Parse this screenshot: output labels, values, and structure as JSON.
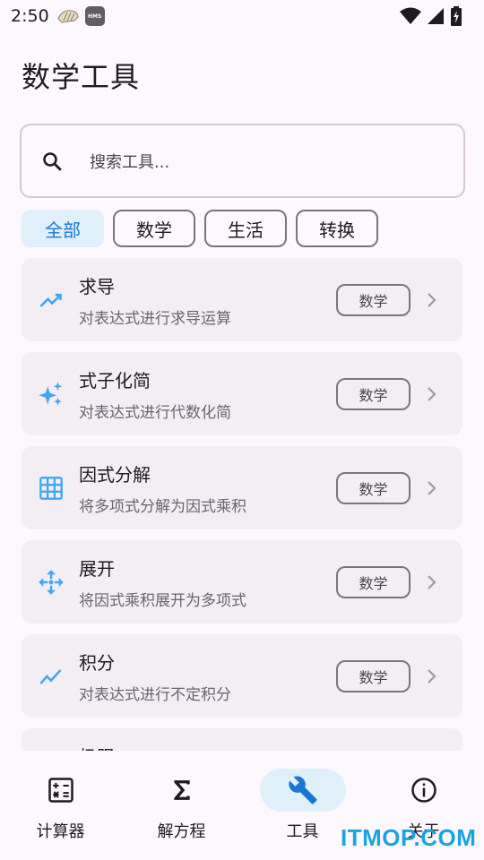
{
  "status_bar": {
    "time": "2:50",
    "notif_icons": [
      "shell-icon",
      "hms-icon"
    ],
    "hms_text": "HMS",
    "right_icons": [
      "wifi-icon",
      "signal-icon",
      "battery-charging-icon"
    ]
  },
  "header": {
    "title": "数学工具"
  },
  "search": {
    "placeholder": "搜索工具..."
  },
  "filters": [
    {
      "label": "全部",
      "selected": true
    },
    {
      "label": "数学",
      "selected": false
    },
    {
      "label": "生活",
      "selected": false
    },
    {
      "label": "转换",
      "selected": false
    }
  ],
  "tools": [
    {
      "name": "求导",
      "description": "对表达式进行求导运算",
      "tag": "数学",
      "icon": "trending-up-icon"
    },
    {
      "name": "式子化简",
      "description": "对表达式进行代数化简",
      "tag": "数学",
      "icon": "sparkle-icon"
    },
    {
      "name": "因式分解",
      "description": "将多项式分解为因式乘积",
      "tag": "数学",
      "icon": "grid-icon"
    },
    {
      "name": "展开",
      "description": "将因式乘积展开为多项式",
      "tag": "数学",
      "icon": "expand-arrows-icon"
    },
    {
      "name": "积分",
      "description": "对表达式进行不定积分",
      "tag": "数学",
      "icon": "show-chart-icon"
    },
    {
      "name": "极限",
      "description": "",
      "tag": "",
      "icon": ""
    }
  ],
  "bottom_nav": [
    {
      "label": "计算器",
      "icon": "calculator-icon",
      "active": false
    },
    {
      "label": "解方程",
      "icon": "sigma-icon",
      "active": false
    },
    {
      "label": "工具",
      "icon": "wrench-icon",
      "active": true
    },
    {
      "label": "关于",
      "icon": "info-icon",
      "active": false
    }
  ],
  "colors": {
    "accent": "#1976d2",
    "accent_container": "#dff0fb",
    "icon_blue": "#42a5f5"
  },
  "watermark": "ITMOP.COM"
}
